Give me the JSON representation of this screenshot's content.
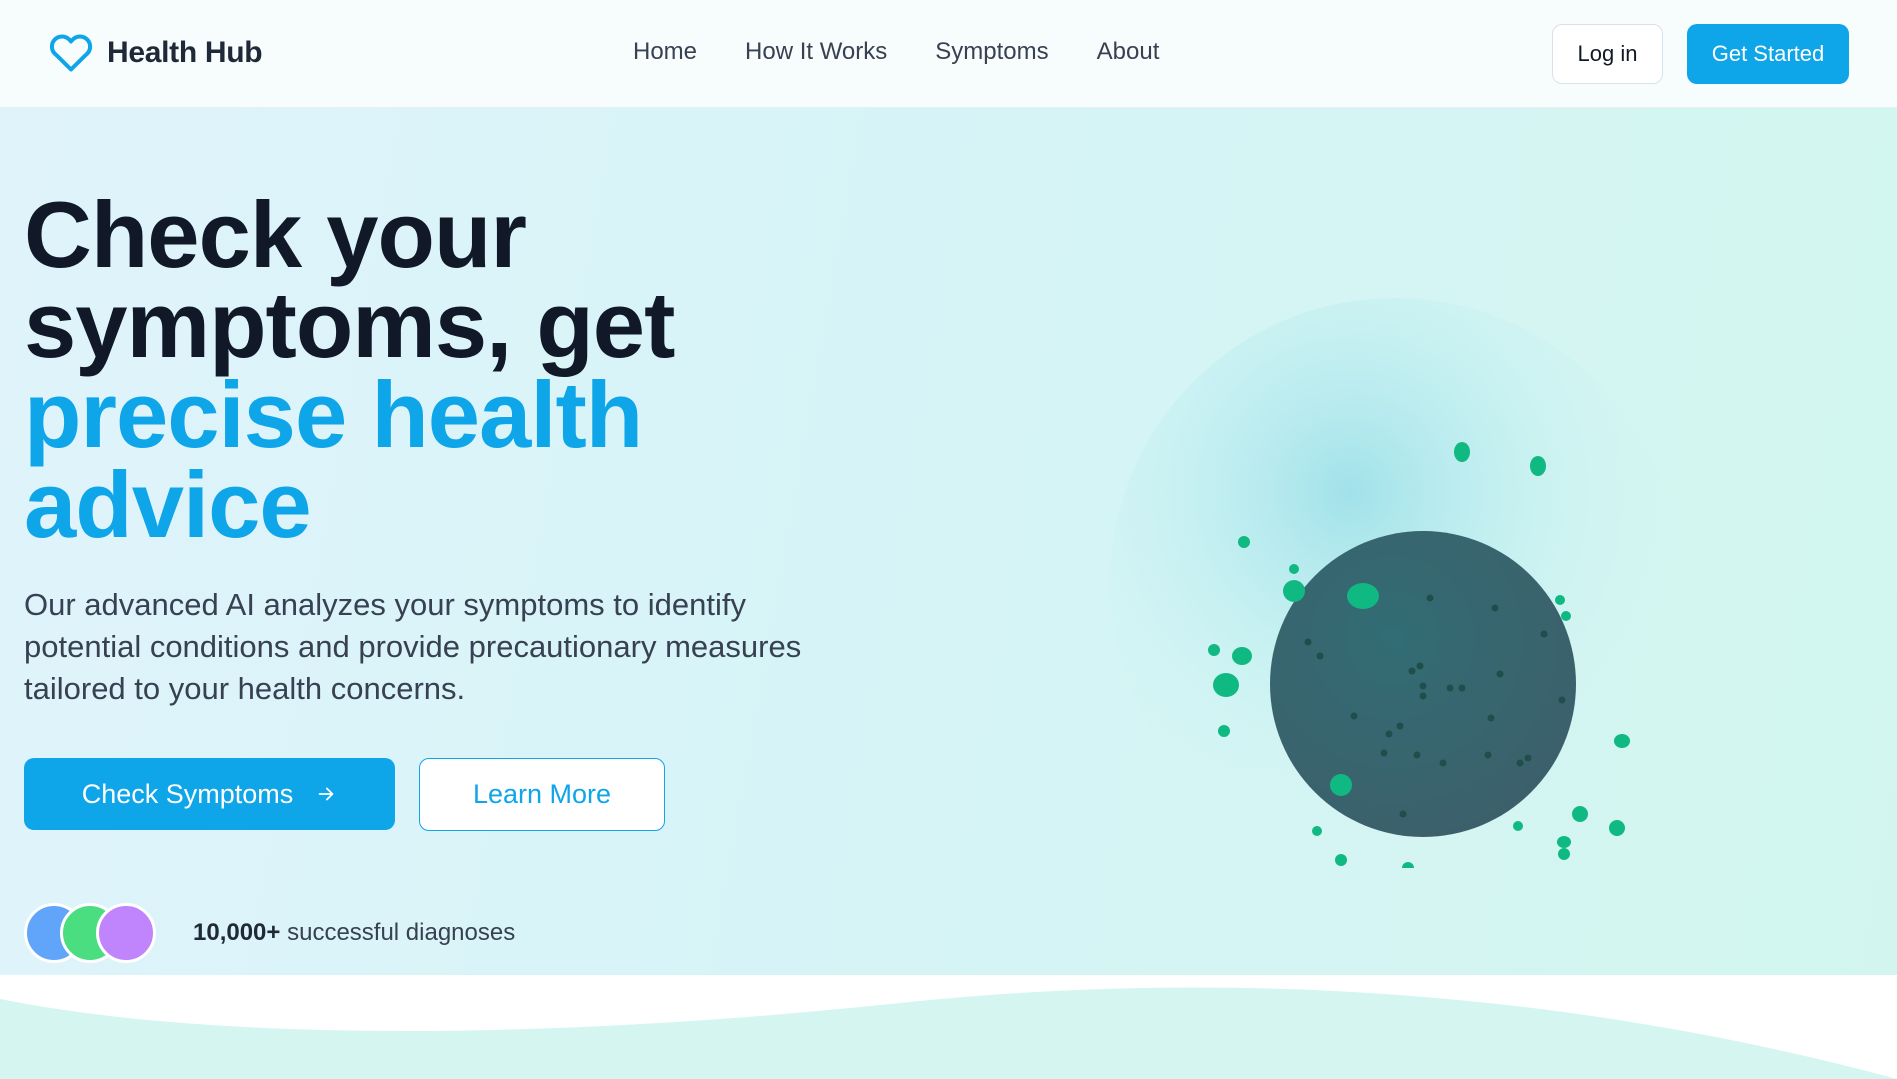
{
  "nav": {
    "brand": "Health Hub",
    "links": [
      "Home",
      "How It Works",
      "Symptoms",
      "About"
    ],
    "login": "Log in",
    "get_started": "Get Started"
  },
  "hero": {
    "title_line1": "Check your",
    "title_line2": "symptoms, get",
    "title_accent_line1": "precise health",
    "title_accent_line2": "advice",
    "description": "Our advanced AI analyzes your symptoms to identify potential conditions and provide precautionary measures tailored to your health concerns.",
    "primary_cta": "Check Symptoms",
    "secondary_cta": "Learn More",
    "stat_value": "10,000+",
    "stat_label": "successful diagnoses"
  },
  "icons": {
    "brand": "heart-icon",
    "cta": "arrow-right-icon"
  },
  "colors": {
    "accent": "#0ea5e9",
    "heading": "#111827",
    "virus_body": "#37656e",
    "virus_particles": "#10b981",
    "avatars": [
      "#60a5fa",
      "#4ade80",
      "#c084fc"
    ]
  }
}
